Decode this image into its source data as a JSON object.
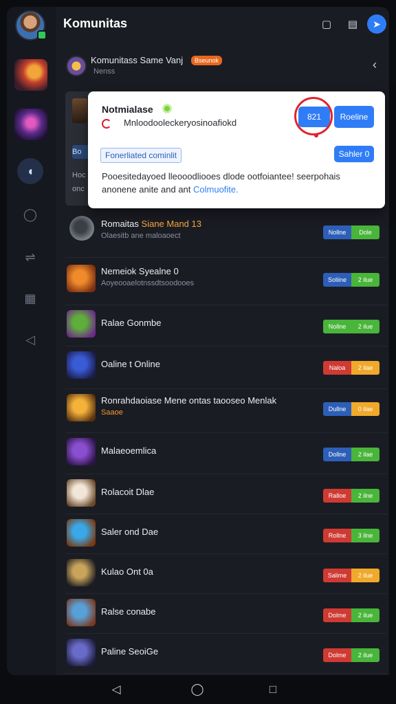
{
  "header": {
    "title": "Komunitas",
    "icons": [
      "chat-icon",
      "store-icon",
      "compass-icon"
    ]
  },
  "community": {
    "title": "Komunitass Same Vanj",
    "badge": "Bseunok",
    "subtitle": "Nenss"
  },
  "background_card": {
    "chip_text": "Bo",
    "line1": "Hoc",
    "line2": "onc"
  },
  "popup": {
    "title": "Notmialase",
    "subtitle": "Mnloodooleckeryosinoafiokd",
    "badge_button": "821",
    "primary_button": "Roeline",
    "tag": "Fonerliated cominlit",
    "secondary_button": "Sahler 0",
    "body": "Pooesitedayoed lleooodliooes dlode ootfoiantee! seerpohais anonene anite and ant ",
    "body_link": "Colmuofite."
  },
  "rows": [
    {
      "name": "Romaitas ",
      "name_highlight": "Siane Mand 13",
      "sub": "Olaesitb ane maloaoect",
      "left": "Nollne",
      "right": "Dole",
      "left_color": "#2d5fb8",
      "right_color": "#49b53a",
      "icon_colors": [
        "#3b3e46",
        "#8f949c"
      ]
    },
    {
      "name": "Nemeiok Syealne 0",
      "name_highlight": "",
      "sub": "Aoyeooaelotnssdtsoodooes",
      "left": "Soliine",
      "right": "2 ilue",
      "left_color": "#2d5fb8",
      "right_color": "#49b53a",
      "icon_colors": [
        "#f08a2a",
        "#7a2e12"
      ]
    },
    {
      "name": "Ralae Gonmbe",
      "name_highlight": "",
      "sub": "",
      "left": "Nollne",
      "right": "2 ilue",
      "left_color": "#49b53a",
      "right_color": "#49b53a",
      "icon_colors": [
        "#5fae3c",
        "#6d2a8a"
      ]
    },
    {
      "name": "Oaline t Online",
      "name_highlight": "",
      "sub": "",
      "left": "Naloa",
      "right": "2 ilae",
      "left_color": "#cf3a33",
      "right_color": "#f0a92a",
      "icon_colors": [
        "#3a5bd6",
        "#1a1c4a"
      ]
    },
    {
      "name": "Ronrahdaoiase Mene ontas taooseo Menlak",
      "name_highlight": "",
      "sub": "Saaoe",
      "sub_orange": true,
      "left": "Dullne",
      "right": "0 ilae",
      "left_color": "#2d5fb8",
      "right_color": "#f0a92a",
      "icon_colors": [
        "#f4b23a",
        "#5a3210"
      ]
    },
    {
      "name": "Malaeoemlica",
      "name_highlight": "",
      "sub": "",
      "left": "Dollne",
      "right": "2 ilae",
      "left_color": "#2d5fb8",
      "right_color": "#49b53a",
      "icon_colors": [
        "#8a4fd0",
        "#2c1446"
      ]
    },
    {
      "name": "Rolacoit Dlae",
      "name_highlight": "",
      "sub": "",
      "left": "Ralloe",
      "right": "2 ilne",
      "left_color": "#cf3a33",
      "right_color": "#49b53a",
      "icon_colors": [
        "#f2e6d8",
        "#6b4a2a"
      ]
    },
    {
      "name": "Saler ond Dae",
      "name_highlight": "",
      "sub": "",
      "left": "Rollne",
      "right": "3 ilne",
      "left_color": "#cf3a33",
      "right_color": "#49b53a",
      "icon_colors": [
        "#3aa8e8",
        "#7a3a12"
      ]
    },
    {
      "name": "Kulao Ont 0a",
      "name_highlight": "",
      "sub": "",
      "left": "Salime",
      "right": "2 ilue",
      "left_color": "#cf3a33",
      "right_color": "#f0a92a",
      "icon_colors": [
        "#c9a45a",
        "#1c1c22"
      ]
    },
    {
      "name": "Ralse conabe",
      "name_highlight": "",
      "sub": "",
      "left": "Dolme",
      "right": "2 ilue",
      "left_color": "#cf3a33",
      "right_color": "#49b53a",
      "icon_colors": [
        "#5aa0d8",
        "#7a3a22"
      ]
    },
    {
      "name": "Paline SeoiGe",
      "name_highlight": "",
      "sub": "",
      "left": "Dolme",
      "right": "2 ilue",
      "left_color": "#cf3a33",
      "right_color": "#49b53a",
      "icon_colors": [
        "#6a6ac8",
        "#1c1c3a"
      ]
    }
  ]
}
